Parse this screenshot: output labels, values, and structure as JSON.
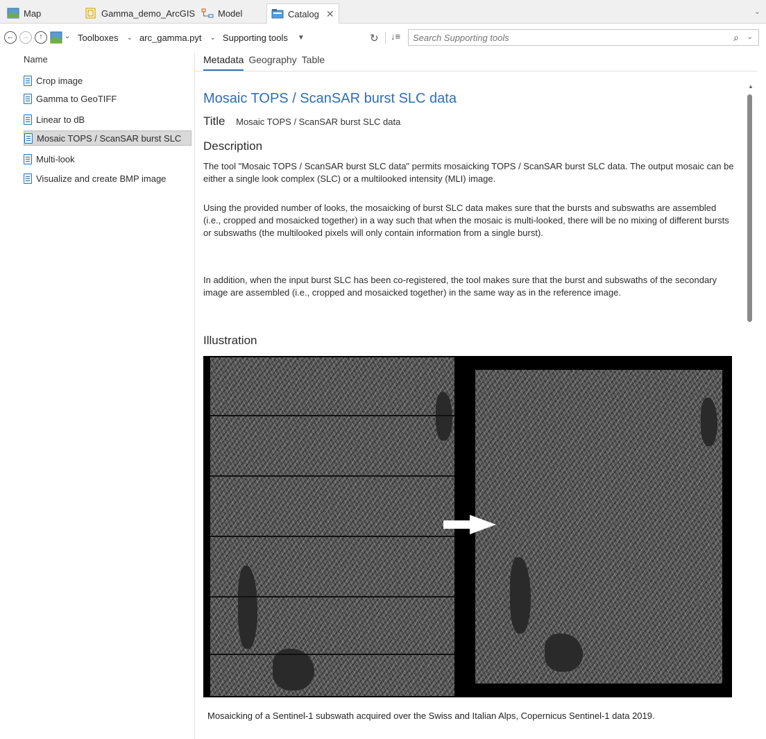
{
  "tabs": [
    {
      "label": "Map",
      "icon": "map-icon"
    },
    {
      "label": "Gamma_demo_ArcGIS",
      "icon": "layout-icon"
    },
    {
      "label": "Model",
      "icon": "model-icon"
    },
    {
      "label": "Catalog",
      "icon": "catalog-icon",
      "active": true
    }
  ],
  "address": {
    "crumbs": [
      "Toolboxes",
      "arc_gamma.pyt",
      "Supporting tools"
    ],
    "search_placeholder": "Search Supporting tools"
  },
  "left_pane": {
    "column_header": "Name",
    "items": [
      {
        "label": "Crop image"
      },
      {
        "label": "Gamma to GeoTIFF"
      },
      {
        "label": "Linear to dB"
      },
      {
        "label": "Mosaic TOPS / ScanSAR burst SLC",
        "selected": true
      },
      {
        "label": "Multi-look"
      },
      {
        "label": "Visualize and create BMP image"
      }
    ]
  },
  "right_pane": {
    "subtabs": [
      "Metadata",
      "Geography",
      "Table"
    ],
    "active_subtab": "Metadata",
    "doc_title": "Mosaic TOPS / ScanSAR burst SLC data",
    "title_label": "Title",
    "title_value": "Mosaic TOPS / ScanSAR burst SLC data",
    "description_heading": "Description",
    "paragraphs": [
      "The tool \"Mosaic TOPS / ScanSAR burst SLC data\" permits mosaicking TOPS / ScanSAR burst SLC data. The output mosaic can be either a single look complex (SLC) or a multilooked intensity (MLI) image.",
      "Using the provided number of looks, the mosaicking of burst SLC data makes sure that the bursts and subswaths are assembled (i.e., cropped and mosaicked together) in a way such that when the mosaic is multi-looked, there will be no mixing of different bursts or subswaths (the multilooked pixels will only contain information from a single burst).",
      "In addition, when the input burst SLC has been co-registered, the tool makes sure that the burst and subswaths of the secondary image are assembled (i.e., cropped and mosaicked together) in the same way as in the reference image."
    ],
    "illustration_heading": "Illustration",
    "caption": "Mosaicking of a Sentinel-1 subswath acquired over the Swiss and Italian Alps, Copernicus Sentinel-1 data 2019."
  },
  "colors": {
    "accent": "#2e75b6",
    "title_blue": "#2e6db4",
    "selection_gray": "#d9d9d9"
  }
}
